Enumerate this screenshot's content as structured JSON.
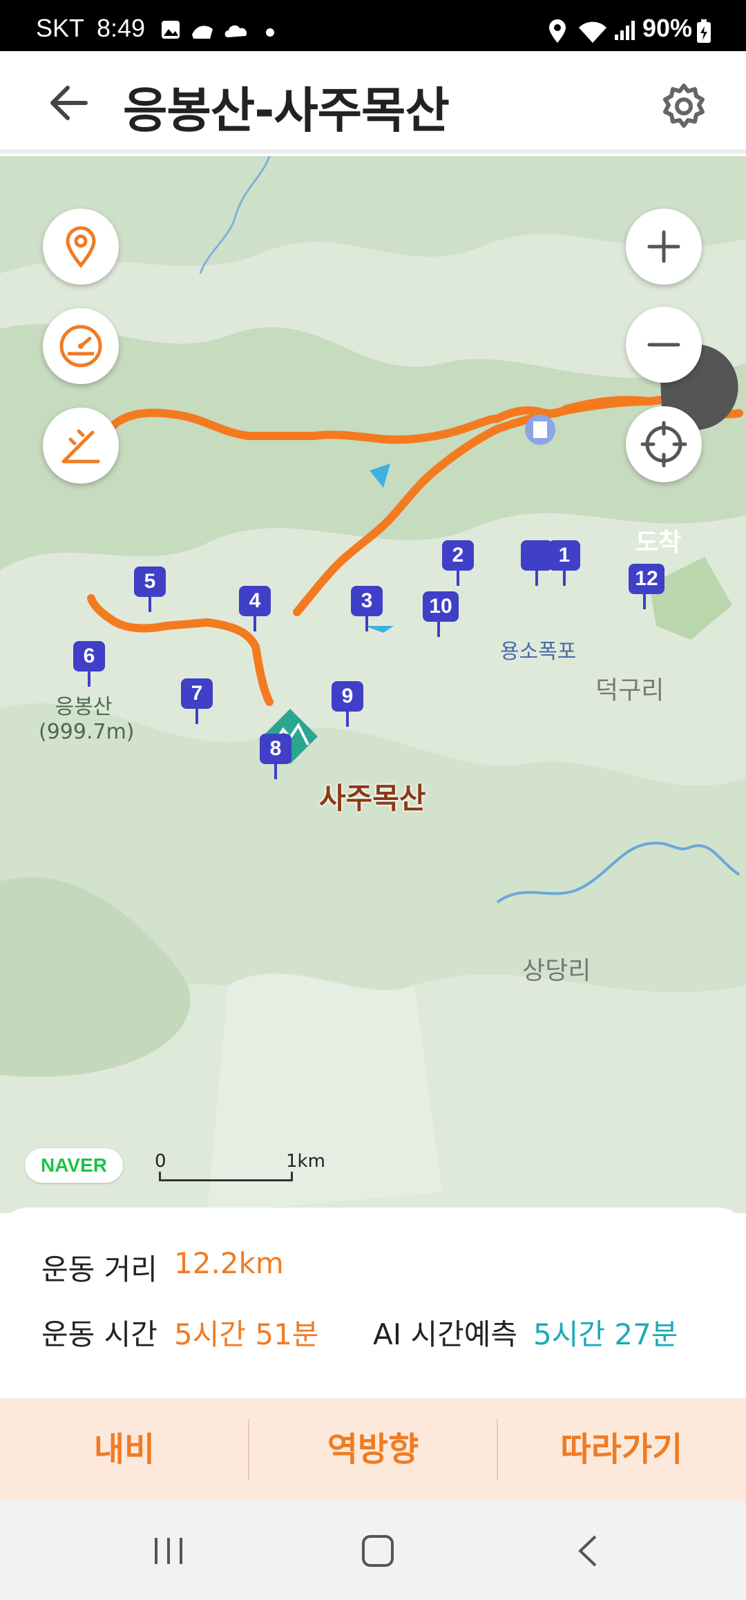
{
  "status_bar": {
    "carrier": "SKT",
    "time": "8:49",
    "battery": "90%"
  },
  "header": {
    "title": "응봉산-사주목산"
  },
  "map": {
    "arrive_label": "도착",
    "place_names": [
      "덕구리",
      "상당리"
    ],
    "poi": "용소폭포",
    "peak_small": {
      "name": "응봉산",
      "elevation": "(999.7m)"
    },
    "peak_big": "사주목산",
    "waypoints": [
      "1",
      "2",
      "3",
      "4",
      "5",
      "6",
      "7",
      "8",
      "9",
      "10",
      "12"
    ],
    "scale": {
      "start": "0",
      "end": "1km"
    },
    "provider": "NAVER",
    "route_color": "#f47a20",
    "waypoint_color": "#3f3fc7"
  },
  "stats": {
    "distance_label": "운동 거리",
    "distance_value": "12.2km",
    "time_label": "운동 시간",
    "time_value": "5시간 51분",
    "ai_label": "AI 시간예측",
    "ai_value": "5시간 27분"
  },
  "actions": {
    "navi": "내비",
    "reverse": "역방향",
    "follow": "따라가기"
  }
}
